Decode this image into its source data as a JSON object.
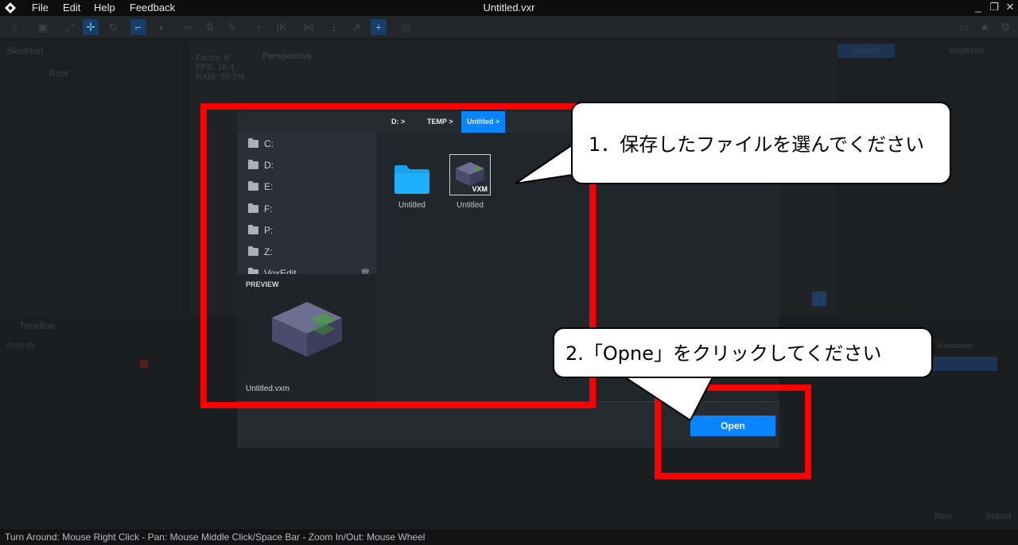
{
  "menu": {
    "file": "File",
    "edit": "Edit",
    "help": "Help",
    "feedback": "Feedback"
  },
  "window": {
    "title": "Untitled.vxr"
  },
  "panels": {
    "skeleton": "Skeleton",
    "root": "Root",
    "viewport_stats": [
      "Faces: 6",
      "FPS: 16.4",
      "RAM: 95.2%"
    ],
    "viewport_tab": "Perspective",
    "library_tab": "Library",
    "inspector_tab": "Inspector",
    "timeline": "Timeline",
    "timecode": "00:00 (0)",
    "animations": "Animations",
    "new_button": "New",
    "import_button": "Import"
  },
  "dialog": {
    "drives": [
      "C:",
      "D:",
      "E:",
      "F:",
      "P:",
      "Z:",
      "VoxEdit"
    ],
    "breadcrumbs": [
      "D: >",
      "TEMP >",
      "Untitled >"
    ],
    "files": [
      {
        "name": "Untitled",
        "type": "folder"
      },
      {
        "name": "Untitled",
        "type": "vxm",
        "badge": "VXM"
      }
    ],
    "preview_label": "PREVIEW",
    "preview_filename": "Untitled.vxm",
    "open_button": "Open"
  },
  "annotations": {
    "step1": "1．保存したファイルを選んでください",
    "step2": "2.「Opne」をクリックしてください",
    "highlight_color": "#ff0000"
  },
  "status_bar": {
    "text": "Turn Around: Mouse Right Click - Pan: Mouse Middle Click/Space Bar - Zoom In/Out: Mouse Wheel"
  },
  "colors": {
    "accent": "#0a84ff",
    "folder": "#19a3f0",
    "cube_top": "#6b6e8e",
    "cube_front": "#4a4a6a",
    "cube_highlight": "#3c9a3c"
  }
}
